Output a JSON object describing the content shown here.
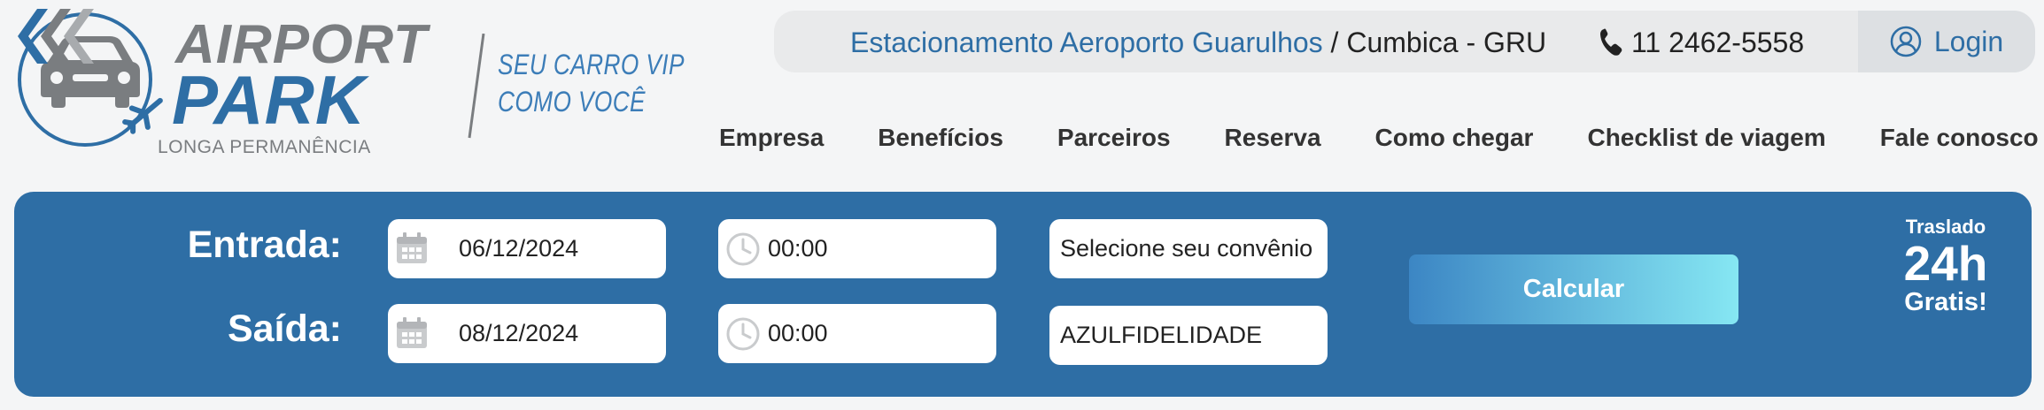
{
  "brand": {
    "line1": "AIRPORT",
    "line2": "PARK",
    "subtitle": "LONGA PERMANÊNCIA",
    "slogan_line1": "SEU CARRO VIP",
    "slogan_line2": "COMO VOCÊ",
    "colors": {
      "primary": "#2e6ea5",
      "grey": "#7a7d80"
    }
  },
  "topbar": {
    "location_link": "Estacionamento Aeroporto Guarulhos",
    "location_rest": " / Cumbica - GRU",
    "phone": "11 2462-5558",
    "phone_icon": "phone-icon",
    "login_label": "Login",
    "login_icon": "user-icon"
  },
  "nav": {
    "items": [
      {
        "label": "Empresa"
      },
      {
        "label": "Benefícios"
      },
      {
        "label": "Parceiros"
      },
      {
        "label": "Reserva"
      },
      {
        "label": "Como chegar"
      },
      {
        "label": "Checklist de viagem"
      },
      {
        "label": "Fale conosco"
      }
    ]
  },
  "booking": {
    "entrada": {
      "label": "Entrada:",
      "date": "06/12/2024",
      "time": "00:00",
      "convenio": "Selecione seu convênio"
    },
    "saida": {
      "label": "Saída:",
      "date": "08/12/2024",
      "time": "00:00",
      "convenio": "AZULFIDELIDADE"
    },
    "calculate_label": "Calcular",
    "promo": {
      "top": "Traslado",
      "mid": "24h",
      "bottom": "Gratis!"
    },
    "colors": {
      "panel": "#2e6ea5",
      "button_start": "#3c86c4",
      "button_end": "#86e7f3"
    }
  }
}
